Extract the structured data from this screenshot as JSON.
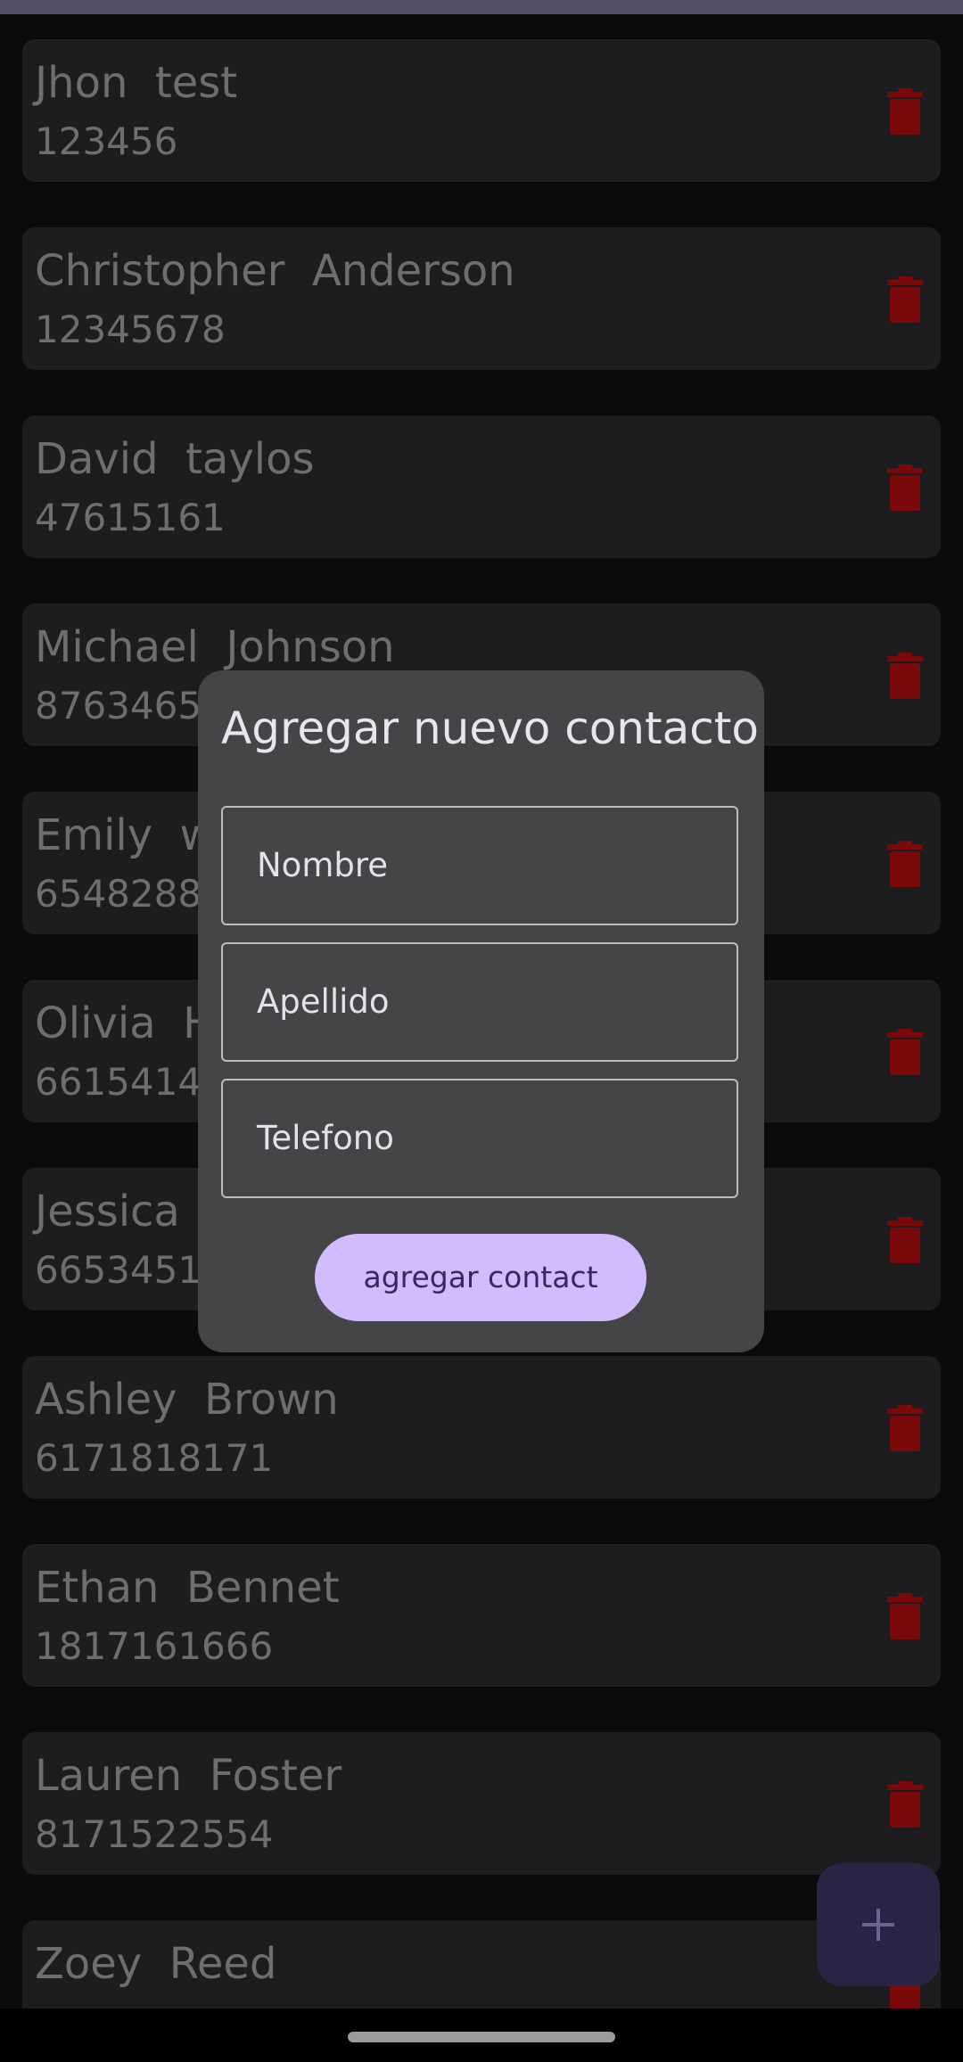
{
  "colors": {
    "background": "#0b0b0d",
    "card": "#1d1d1f",
    "dimmed_text": "#6e6e70",
    "delete_icon": "#7a0a0a",
    "dialog": "#454547",
    "accent_button": "#d0bcff",
    "fab": "#2a2344"
  },
  "contacts": [
    {
      "name": "Jhon  test",
      "phone": "123456"
    },
    {
      "name": "Christopher  Anderson",
      "phone": "12345678"
    },
    {
      "name": "David  taylos",
      "phone": "47615161"
    },
    {
      "name": "Michael  Johnson",
      "phone": "87634654"
    },
    {
      "name": "Emily  w",
      "phone": "65482882"
    },
    {
      "name": "Olivia  H",
      "phone": "66154141"
    },
    {
      "name": "Jessica",
      "phone": "66534516"
    },
    {
      "name": "Ashley  Brown",
      "phone": "6171818171"
    },
    {
      "name": "Ethan  Bennet",
      "phone": "1817161666"
    },
    {
      "name": "Lauren  Foster",
      "phone": "8171522554"
    },
    {
      "name": "Zoey  Reed",
      "phone": ""
    }
  ],
  "dialog": {
    "title": "Agregar nuevo contacto",
    "fields": {
      "nombre": "Nombre",
      "apellido": "Apellido",
      "telefono": "Telefono"
    },
    "submit_label": "agregar contact"
  },
  "icons": {
    "delete": "trash-icon",
    "add": "plus-icon"
  }
}
